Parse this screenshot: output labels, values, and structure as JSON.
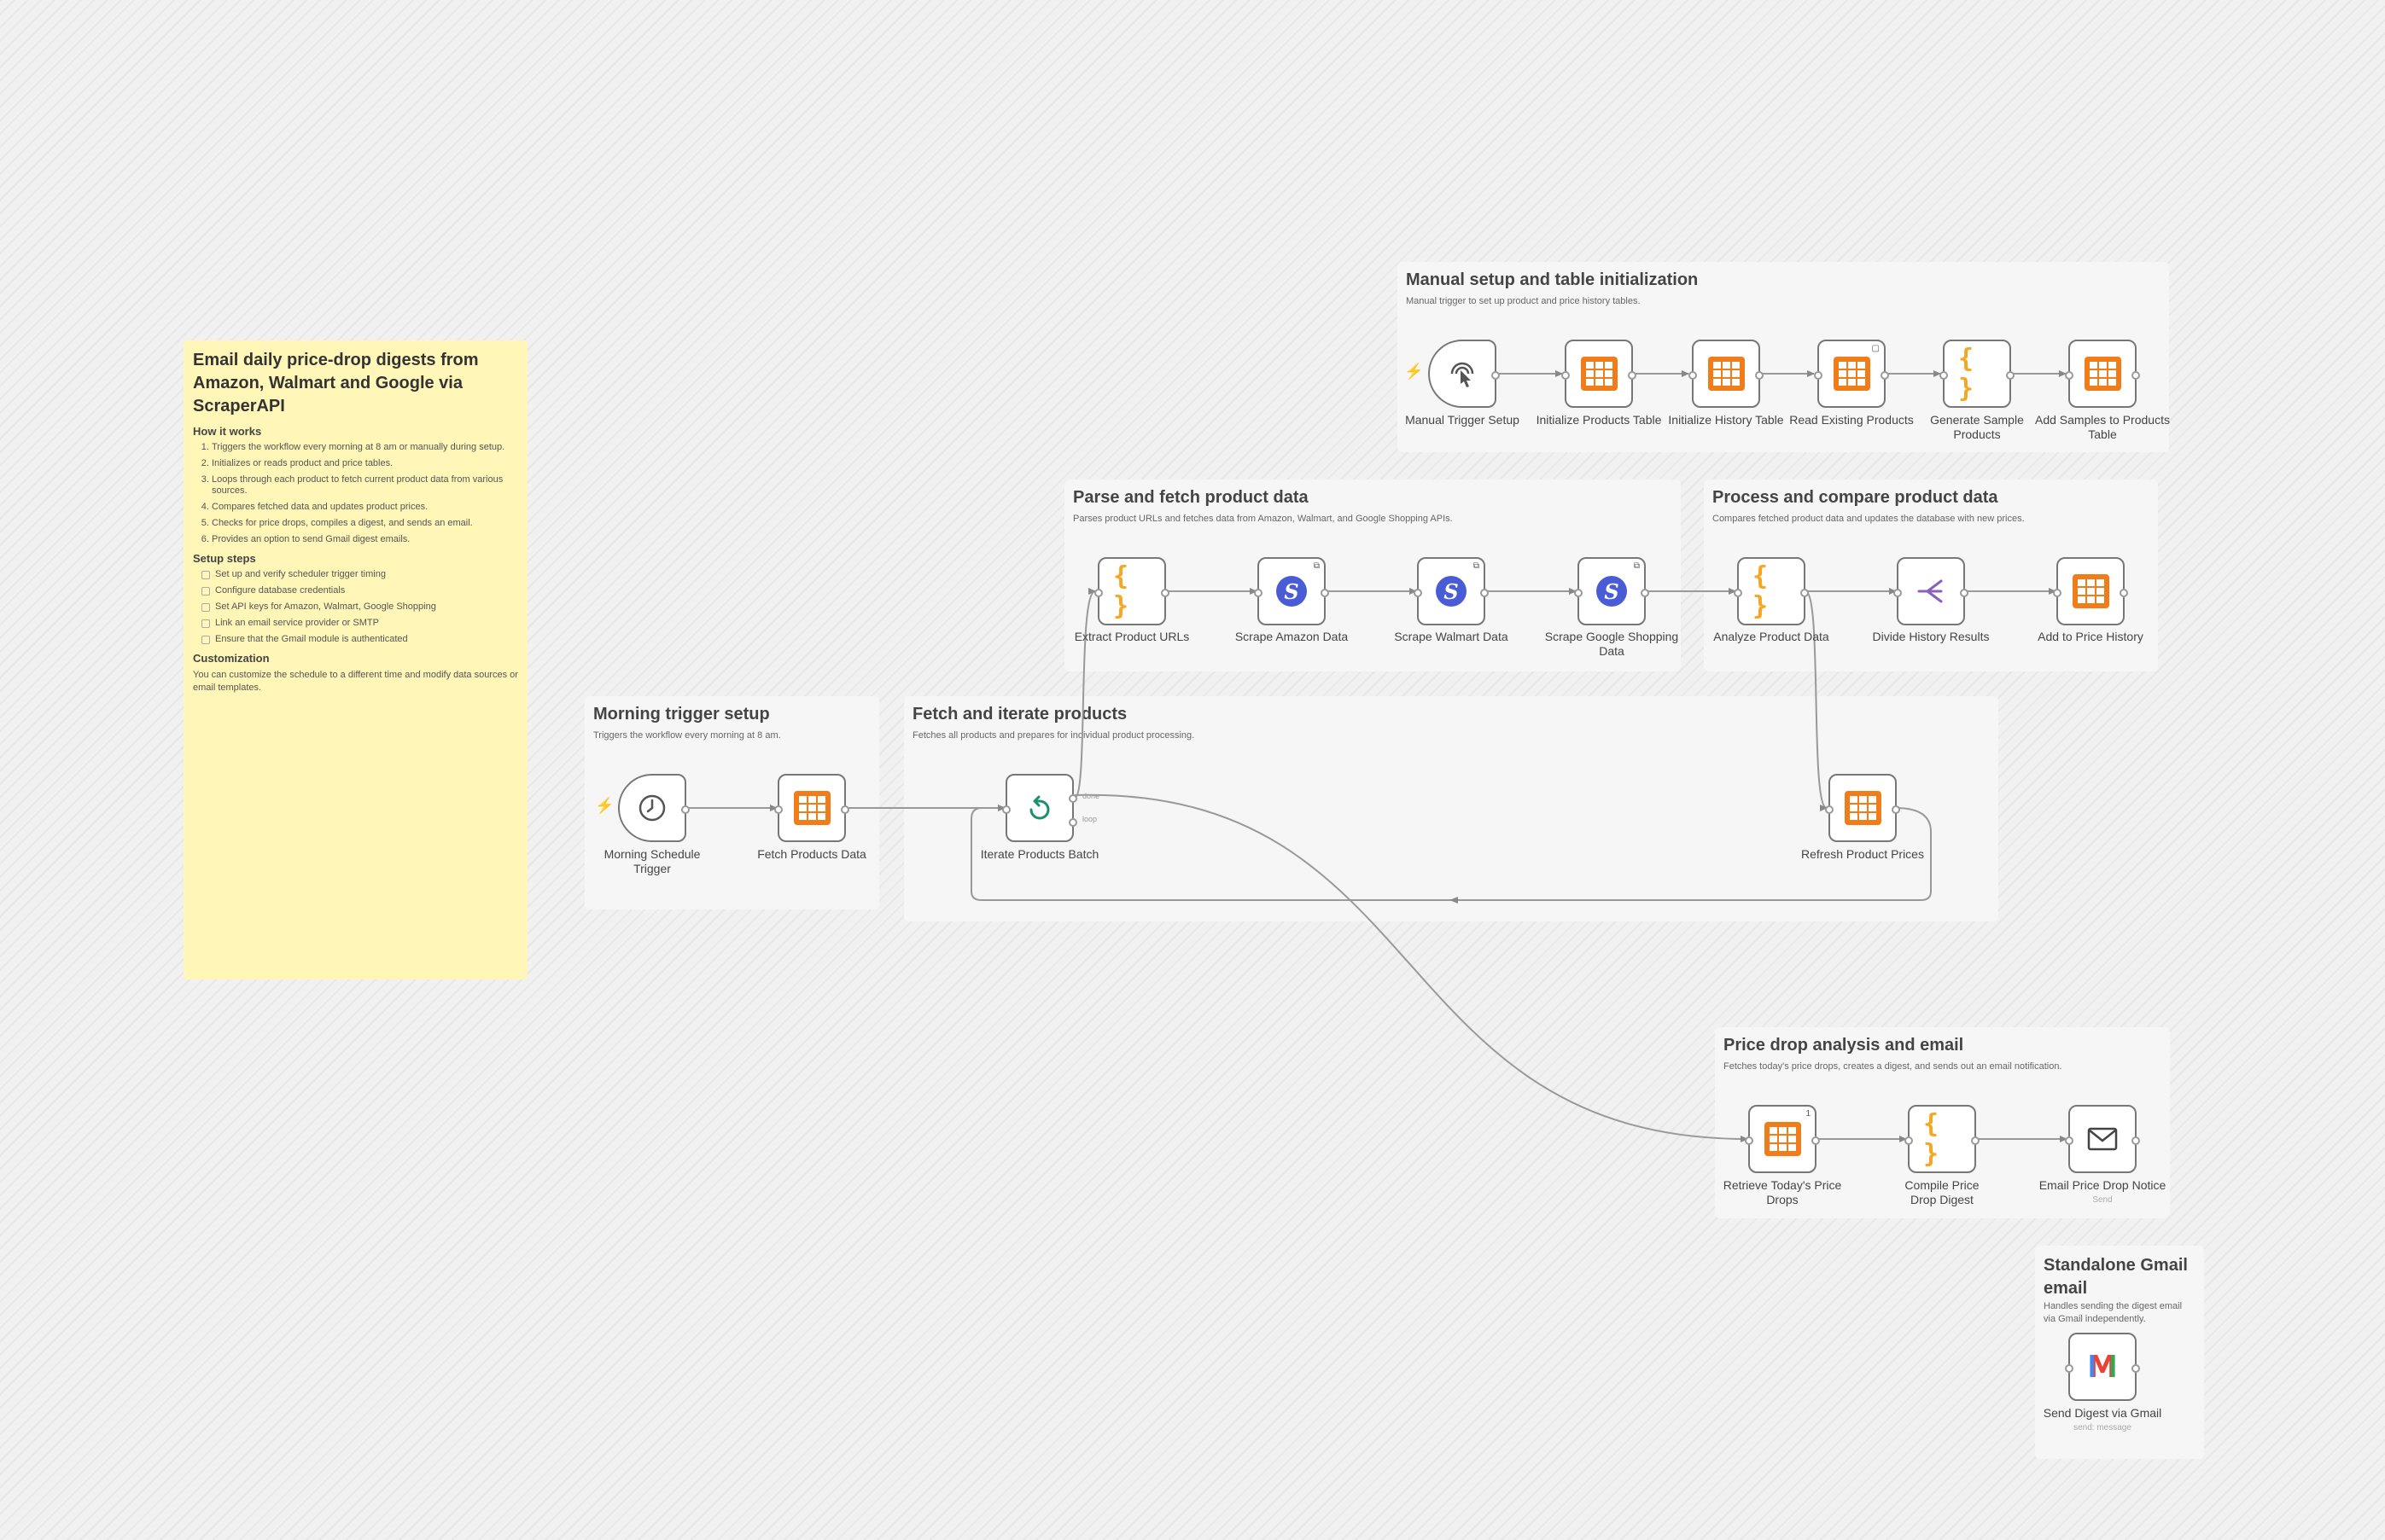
{
  "app": "n8n workflow editor",
  "colors": {
    "accent": "#ff6d3f",
    "table": "#f07c1a",
    "code": "#f5a623",
    "scraper": "#4a5bd6",
    "loop": "#1c8f6f",
    "split": "#8b5fbf",
    "sticky": "#fff6b8"
  },
  "sticky": {
    "title": "Email daily price-drop digests from Amazon, Walmart and Google via ScraperAPI",
    "how_title": "How it works",
    "how_items": [
      "Triggers the workflow every morning at 8 am or manually during setup.",
      "Initializes or reads product and price tables.",
      "Loops through each product to fetch current product data from various sources.",
      "Compares fetched data and updates product prices.",
      "Checks for price drops, compiles a digest, and sends an email.",
      "Provides an option to send Gmail digest emails."
    ],
    "setup_title": "Setup steps",
    "setup_items": [
      "Set up and verify scheduler trigger timing",
      "Configure database credentials",
      "Set API keys for Amazon, Walmart, Google Shopping",
      "Link an email service provider or SMTP",
      "Ensure that the Gmail module is authenticated"
    ],
    "custom_title": "Customization",
    "custom_text": "You can customize the schedule to a different time and modify data sources or email templates."
  },
  "groups": {
    "manual": {
      "title": "Manual setup and table initialization",
      "desc": "Manual trigger to set up product and price history tables."
    },
    "parse": {
      "title": "Parse and fetch product data",
      "desc": "Parses product URLs and fetches data from Amazon, Walmart, and Google Shopping APIs."
    },
    "process": {
      "title": "Process and compare product data",
      "desc": "Compares fetched product data and updates the database with new prices."
    },
    "morning": {
      "title": "Morning trigger setup",
      "desc": "Triggers the workflow every morning at 8 am."
    },
    "fetch": {
      "title": "Fetch and iterate products",
      "desc": "Fetches all products and prepares for individual product processing."
    },
    "price": {
      "title": "Price drop analysis and email",
      "desc": "Fetches today's price drops, creates a digest, and sends out an email notification."
    },
    "gmail": {
      "title": "Standalone Gmail email",
      "desc": "Handles sending the digest email via Gmail independently."
    }
  },
  "nodes": {
    "manual_trigger": {
      "label": "Manual Trigger Setup",
      "icon": "cursor-click-icon"
    },
    "init_products": {
      "label": "Initialize Products Table",
      "icon": "table-icon"
    },
    "init_history": {
      "label": "Initialize History Table",
      "icon": "table-icon"
    },
    "read_existing": {
      "label": "Read Existing Products",
      "icon": "table-icon"
    },
    "gen_samples": {
      "label": "Generate Sample Products",
      "icon": "code-icon"
    },
    "add_samples": {
      "label": "Add Samples to Products Table",
      "icon": "table-icon"
    },
    "extract_urls": {
      "label": "Extract Product URLs",
      "icon": "code-icon"
    },
    "scrape_amazon": {
      "label": "Scrape Amazon Data",
      "icon": "scraperapi-icon"
    },
    "scrape_walmart": {
      "label": "Scrape Walmart Data",
      "icon": "scraperapi-icon"
    },
    "scrape_google": {
      "label": "Scrape Google Shopping Data",
      "icon": "scraperapi-icon"
    },
    "analyze": {
      "label": "Analyze Product Data",
      "icon": "code-icon"
    },
    "divide": {
      "label": "Divide History Results",
      "icon": "split-icon"
    },
    "add_history": {
      "label": "Add to Price History",
      "icon": "table-icon"
    },
    "schedule": {
      "label": "Morning Schedule Trigger",
      "icon": "clock-icon"
    },
    "fetch_products": {
      "label": "Fetch Products Data",
      "icon": "table-icon"
    },
    "iterate": {
      "label": "Iterate Products Batch",
      "icon": "loop-icon",
      "port_done": "done",
      "port_loop": "loop"
    },
    "refresh": {
      "label": "Refresh Product Prices",
      "icon": "table-icon"
    },
    "retrieve": {
      "label": "Retrieve Today's Price Drops",
      "icon": "table-icon",
      "badge": "1"
    },
    "compile": {
      "label": "Compile Price Drop Digest",
      "icon": "code-icon"
    },
    "email": {
      "label": "Email Price Drop Notice",
      "sub": "Send",
      "icon": "mail-icon"
    },
    "gmail": {
      "label": "Send Digest via Gmail",
      "sub": "send: message",
      "icon": "gmail-icon"
    }
  }
}
